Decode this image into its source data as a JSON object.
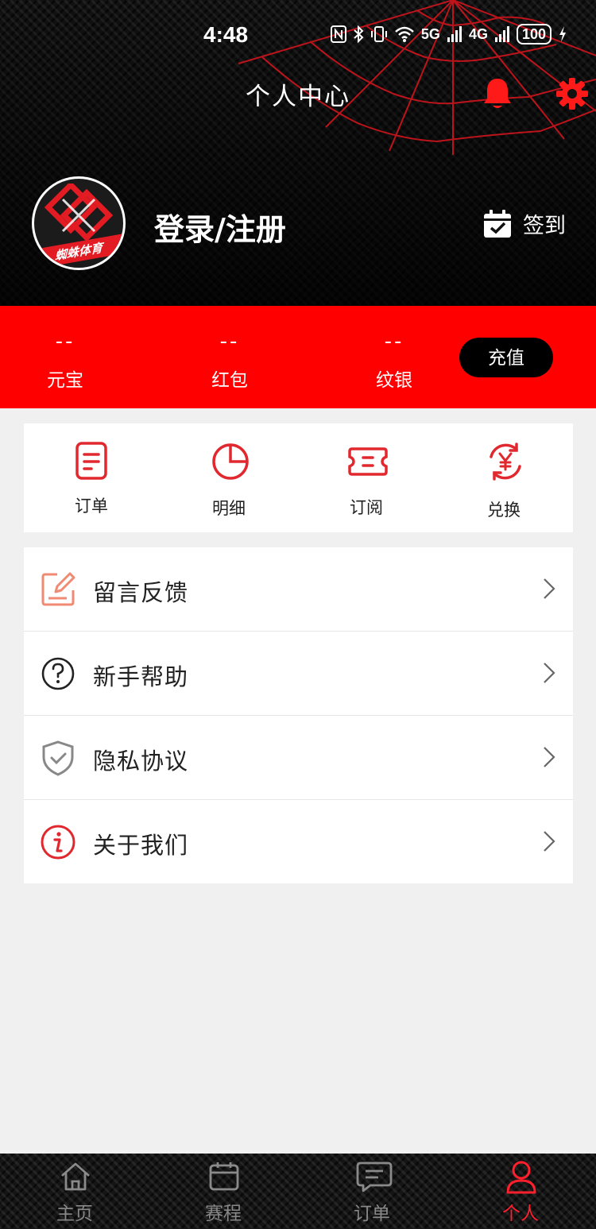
{
  "status_bar": {
    "time": "4:48",
    "network_5g": "5G",
    "network_4g": "4G",
    "battery": "100"
  },
  "header": {
    "title": "个人中心",
    "login_text": "登录/注册",
    "avatar_text": "蜘蛛体育",
    "signin_label": "签到"
  },
  "wallet": {
    "items": [
      {
        "value": "--",
        "label": "元宝"
      },
      {
        "value": "--",
        "label": "红包"
      },
      {
        "value": "--",
        "label": "纹银"
      }
    ],
    "recharge_label": "充值"
  },
  "quick_actions": [
    {
      "label": "订单",
      "icon": "order-icon"
    },
    {
      "label": "明细",
      "icon": "pie-chart-icon"
    },
    {
      "label": "订阅",
      "icon": "ticket-icon"
    },
    {
      "label": "兑换",
      "icon": "exchange-icon"
    }
  ],
  "menu": [
    {
      "label": "留言反馈",
      "icon": "edit-icon"
    },
    {
      "label": "新手帮助",
      "icon": "help-icon"
    },
    {
      "label": "隐私协议",
      "icon": "shield-check-icon"
    },
    {
      "label": "关于我们",
      "icon": "info-icon"
    }
  ],
  "bottom_nav": [
    {
      "label": "主页",
      "icon": "home-icon",
      "active": false
    },
    {
      "label": "赛程",
      "icon": "calendar-icon",
      "active": false
    },
    {
      "label": "订单",
      "icon": "message-icon",
      "active": false
    },
    {
      "label": "个人",
      "icon": "user-icon",
      "active": true
    }
  ],
  "colors": {
    "accent": "#ff0000",
    "icon_red": "#e0282e",
    "nav_active": "#ff1f2d",
    "background": "#f0f0f0"
  }
}
